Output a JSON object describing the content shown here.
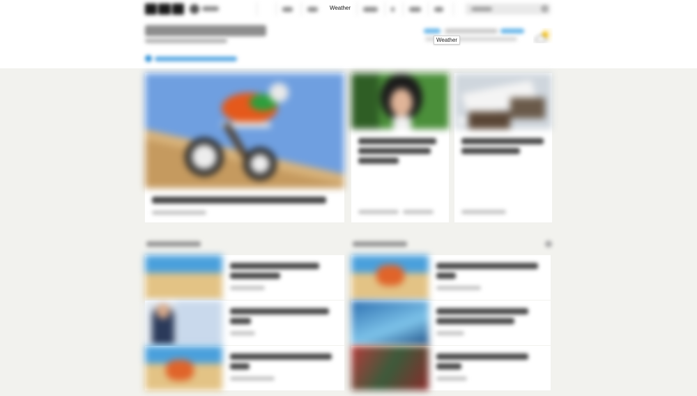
{
  "nav": {
    "active_label": "Weather",
    "search_placeholder": ""
  },
  "weather": {
    "tooltip": "Weather"
  },
  "colors": {
    "page_bg": "#f2f2ee",
    "accent_blue": "#2c8fd6",
    "weather_sun": "#f4c21a"
  },
  "icons": {
    "search": "search-icon",
    "weather": "partly-sunny-icon",
    "settings": "gear-icon"
  }
}
